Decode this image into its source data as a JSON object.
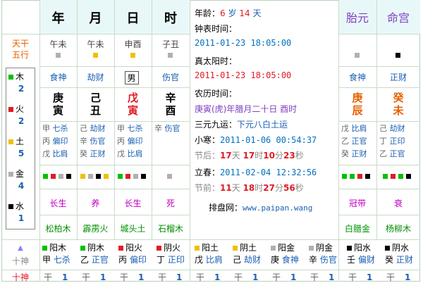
{
  "header": {
    "year": "年",
    "month": "月",
    "day": "日",
    "hour": "时",
    "taiyuan": "胎元",
    "minggong": "命宫"
  },
  "left_labels": {
    "tiangan_wuxing_1": "天干",
    "tiangan_wuxing_2": "五行",
    "shishen_1": "十神",
    "shishen_2": "十神"
  },
  "wuxing_counts": [
    {
      "name": "木",
      "count": "2",
      "color": "#00c000"
    },
    {
      "name": "火",
      "count": "2",
      "color": "#e01b24"
    },
    {
      "name": "土",
      "count": "5",
      "color": "#f0c000"
    },
    {
      "name": "金",
      "count": "4",
      "color": "#b0b0b0"
    },
    {
      "name": "水",
      "count": "1",
      "color": "#000000"
    }
  ],
  "pillars": [
    {
      "ganzhi_top": "午未",
      "sq_color": "#b0b0b0",
      "shishen": "食神",
      "gan": "庚",
      "zhi": "寅",
      "hidden": [
        [
          "甲",
          "七杀"
        ],
        [
          "丙",
          "偏印"
        ],
        [
          "戊",
          "比肩"
        ]
      ],
      "changsheng": "长生",
      "nayin": "松柏木"
    },
    {
      "ganzhi_top": "午未",
      "sq_color": "#f0c000",
      "shishen": "劫财",
      "gan": "己",
      "zhi": "丑",
      "hidden": [
        [
          "己",
          "劫财"
        ],
        [
          "辛",
          "伤官"
        ],
        [
          "癸",
          "正财"
        ]
      ],
      "changsheng": "养",
      "nayin": "霹雳火"
    },
    {
      "ganzhi_top": "申酉",
      "sq_color": "#f0c000",
      "shishen": "男",
      "gan": "戊",
      "zhi": "寅",
      "hidden": [
        [
          "甲",
          "七杀"
        ],
        [
          "丙",
          "偏印"
        ],
        [
          "戊",
          "比肩"
        ]
      ],
      "changsheng": "长生",
      "nayin": "城头土"
    },
    {
      "ganzhi_top": "子丑",
      "sq_color": "#b0b0b0",
      "shishen": "伤官",
      "gan": "辛",
      "zhi": "酉",
      "hidden": [
        [
          "辛",
          "伤官"
        ],
        [
          "",
          ""
        ],
        [
          "",
          ""
        ]
      ],
      "changsheng": "死",
      "nayin": "石榴木"
    }
  ],
  "right_pillars": [
    {
      "sq_color": "#b0b0b0",
      "shishen": "食神",
      "gan": "庚",
      "zhi": "辰",
      "hidden": [
        [
          "戊",
          "比肩"
        ],
        [
          "乙",
          "正官"
        ],
        [
          "癸",
          "正财"
        ]
      ],
      "changsheng": "冠带",
      "nayin": "白腊金"
    },
    {
      "sq_color": "#000000",
      "shishen": "正财",
      "gan": "癸",
      "zhi": "未",
      "hidden": [
        [
          "己",
          "劫财"
        ],
        [
          "丁",
          "正印"
        ],
        [
          "乙",
          "正官"
        ]
      ],
      "changsheng": "衰",
      "nayin": "杨柳木"
    }
  ],
  "info": {
    "age_label": "年龄：",
    "age_years": "6",
    "age_sui": "岁",
    "age_days": "14",
    "age_tian": "天",
    "clock_label": "钟表时间：",
    "clock_value": "2011-01-23 18:05:00",
    "solar_label": "真太阳时：",
    "solar_value": "2011-01-23 18:05:00",
    "lunar_label": "农历时间：",
    "lunar_value": "庚寅(虎)年腊月二十日 酉时",
    "sanyuan_label": "三元九运：",
    "sanyuan_value": "下元八白土运",
    "xiaohan_label": "小寒：",
    "xiaohan_value": "2011-01-06 00:54:37",
    "jiehou_prefix": "节后：",
    "jiehou_d": "17",
    "jiehou_h": "17",
    "jiehou_m": "10",
    "jiehou_s": "23",
    "lichun_label": "立春：",
    "lichun_value": "2011-02-04 12:32:56",
    "jieqian_prefix": "节前：",
    "jieqian_d": "11",
    "jieqian_h": "18",
    "jieqian_m": "27",
    "jieqian_s": "56",
    "unit_tian": "天",
    "unit_shi": "时",
    "unit_fen": "分",
    "unit_miao": "秒",
    "site_label": "排盘网：",
    "site_value": "www.paipan.wang"
  },
  "bottom_row": [
    {
      "sq": "#00c000",
      "yy": "阳木",
      "gan": "甲",
      "ss": "七杀"
    },
    {
      "sq": "#00c000",
      "yy": "阴木",
      "gan": "乙",
      "ss": "正官"
    },
    {
      "sq": "#e01b24",
      "yy": "阳火",
      "gan": "丙",
      "ss": "偏印"
    },
    {
      "sq": "#e01b24",
      "yy": "阴火",
      "gan": "丁",
      "ss": "正印"
    },
    {
      "sq": "#f0c000",
      "yy": "阳土",
      "gan": "戊",
      "ss": "比肩"
    },
    {
      "sq": "#f0c000",
      "yy": "阴土",
      "gan": "己",
      "ss": "劫财"
    },
    {
      "sq": "#b0b0b0",
      "yy": "阳金",
      "gan": "庚",
      "ss": "食神"
    },
    {
      "sq": "#b0b0b0",
      "yy": "阴金",
      "gan": "辛",
      "ss": "伤官"
    },
    {
      "sq": "#000000",
      "yy": "阳水",
      "gan": "壬",
      "ss": "偏财"
    },
    {
      "sq": "#000000",
      "yy": "阴水",
      "gan": "癸",
      "ss": "正财"
    }
  ],
  "bottom_last": [
    {
      "a": "干",
      "b": "1"
    },
    {
      "a": "干",
      "b": "1"
    },
    {
      "a": "干",
      "b": "1"
    },
    {
      "a": "干",
      "b": "1"
    },
    {
      "a": "干",
      "b": "1"
    },
    {
      "a": "干",
      "b": "1"
    },
    {
      "a": "干",
      "b": "1"
    },
    {
      "a": "干",
      "b": "1"
    },
    {
      "a": "干",
      "b": "1"
    },
    {
      "a": "干",
      "b": "1"
    }
  ],
  "arrow_up": "▲"
}
